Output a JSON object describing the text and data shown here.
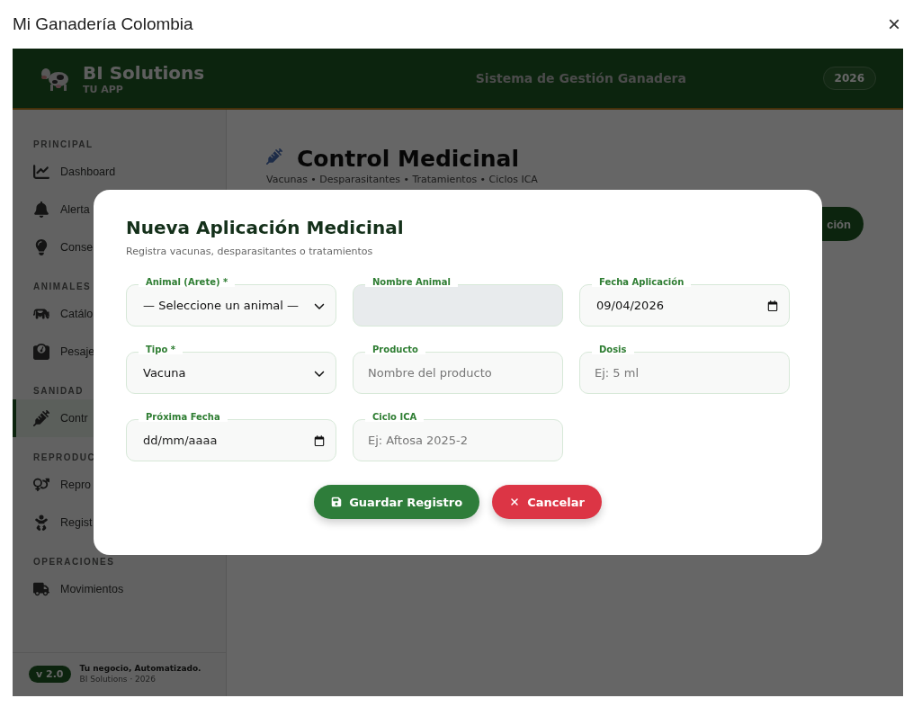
{
  "window": {
    "title": "Mi Ganadería Colombia",
    "close": "×"
  },
  "header": {
    "brand": "BI Solutions",
    "tagline": "TU APP",
    "title": "Sistema de Gestión Ganadera",
    "year": "2026"
  },
  "sidebar": {
    "sections": [
      {
        "label": "PRINCIPAL",
        "items": [
          {
            "label": "Dashboard",
            "selected": false
          },
          {
            "label": "Alerta",
            "selected": false
          },
          {
            "label": "Conse",
            "selected": false
          }
        ]
      },
      {
        "label": "ANIMALES",
        "items": [
          {
            "label": "Catálo",
            "selected": false
          },
          {
            "label": "Pesaje",
            "selected": false
          }
        ]
      },
      {
        "label": "SANIDAD",
        "items": [
          {
            "label": "Contr",
            "selected": true
          }
        ]
      },
      {
        "label": "REPRODUC",
        "items": [
          {
            "label": "Repro",
            "selected": false
          },
          {
            "label": "Regist",
            "selected": false
          }
        ]
      },
      {
        "label": "OPERACIONES",
        "items": [
          {
            "label": "Movimientos",
            "selected": false
          }
        ]
      }
    ],
    "footer": {
      "version": "v 2.0",
      "slogan": "Tu negocio, Automatizado.",
      "credit": "BI Solutions · 2026"
    }
  },
  "page": {
    "title": "Control Medicinal",
    "subtitle": "Vacunas • Desparasitantes • Tratamientos • Ciclos ICA",
    "action": "ción"
  },
  "modal": {
    "title": "Nueva Aplicación Medicinal",
    "subtitle": "Registra vacunas, desparasitantes o tratamientos",
    "fields": [
      {
        "label": "Animal (Arete) *",
        "kind": "select",
        "value": "— Seleccione un animal —",
        "disabled": false
      },
      {
        "label": "Nombre Animal",
        "kind": "text",
        "disabled": true
      },
      {
        "label": "Fecha Aplicación",
        "kind": "date",
        "value": "09/04/2026",
        "disabled": false
      },
      {
        "label": "Tipo *",
        "kind": "select",
        "value": "Vacuna",
        "disabled": false
      },
      {
        "label": "Producto",
        "kind": "text",
        "placeholder": "Nombre del producto",
        "disabled": false
      },
      {
        "label": "Dosis",
        "kind": "text",
        "placeholder": "Ej: 5 ml",
        "disabled": false
      },
      {
        "label": "Próxima Fecha",
        "kind": "date",
        "placeholder": "dd/mm/aaaa",
        "disabled": false
      },
      {
        "label": "Ciclo ICA",
        "kind": "text",
        "placeholder": "Ej: Aftosa 2025-2",
        "disabled": false
      }
    ],
    "buttons": [
      {
        "label": "Guardar Registro",
        "kind": "save"
      },
      {
        "label": "Cancelar",
        "kind": "cancel"
      }
    ]
  }
}
